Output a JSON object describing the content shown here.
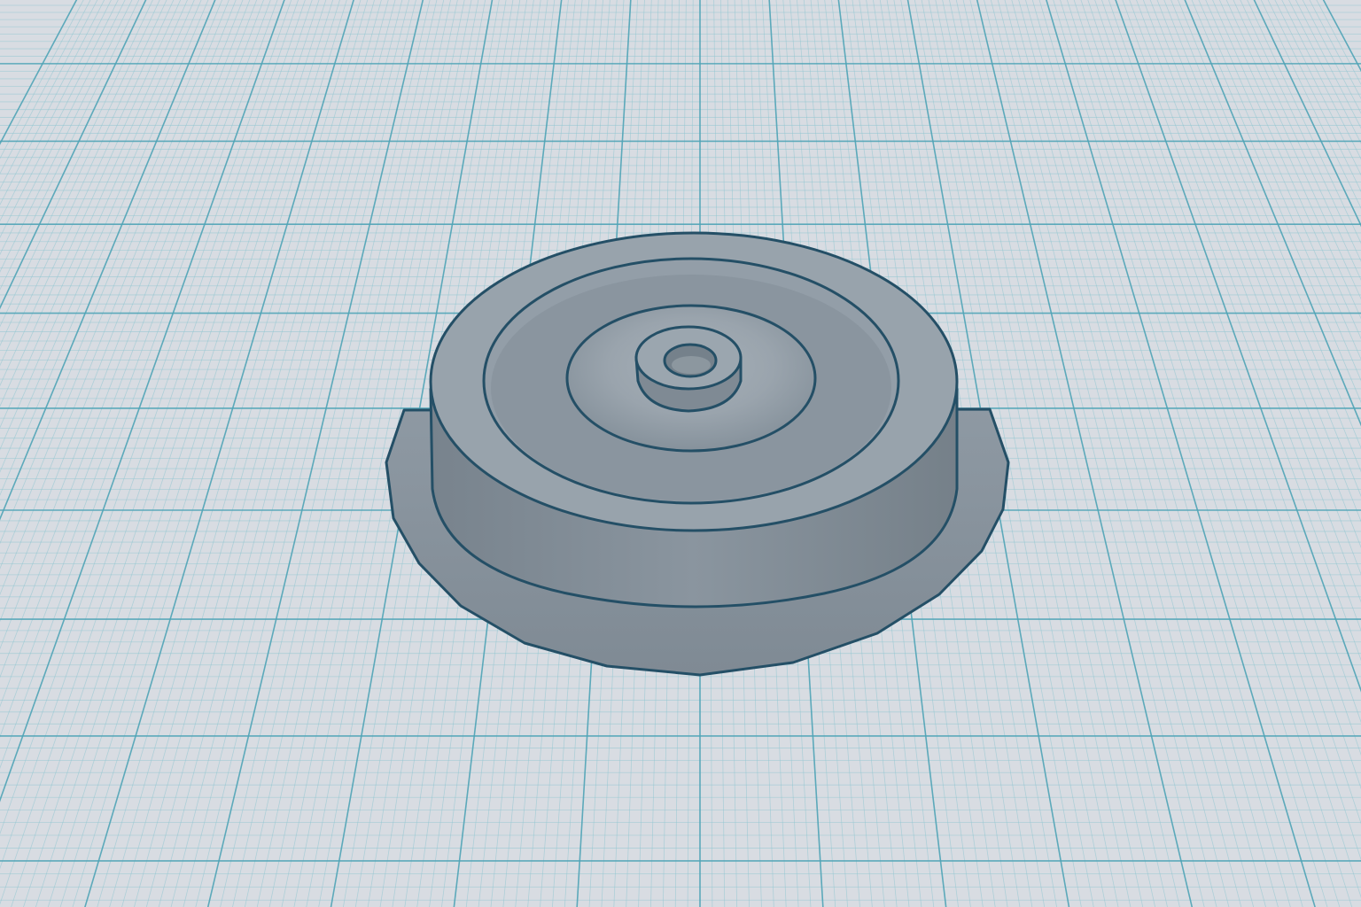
{
  "workplane": {
    "background_color": "#d8dce2",
    "minor_grid_color": "#8cc4cf",
    "major_grid_color": "#4fa3b6",
    "perspective": true,
    "vanishing_point": "center-top"
  },
  "model": {
    "name": "",
    "shape": "stepped cylindrical part with flared base flange, concentric grooves and central hollow boss",
    "face_color": "#8f9aa4",
    "top_face_color": "#9aa5ae",
    "side_color": "#7c8892",
    "shadow_color": "#6f7b85",
    "edge_color": "#244f66",
    "visible_features": [
      "base-flange",
      "main-cylinder",
      "outer-groove-ring",
      "inner-recess",
      "center-boss",
      "center-hole"
    ]
  }
}
